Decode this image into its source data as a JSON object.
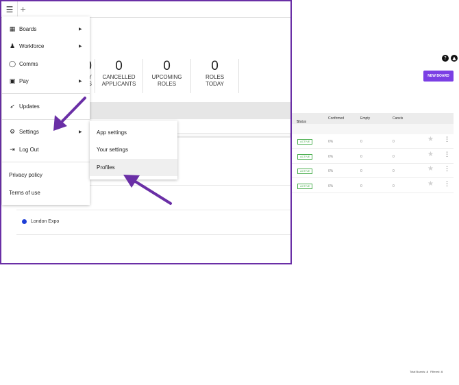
{
  "topbar": {
    "menu_icon": "hamburger-icon",
    "add_icon": "plus-icon",
    "add_label": "+"
  },
  "stats": [
    {
      "value": "0",
      "label_line1": "TY",
      "label_line2": "ES"
    },
    {
      "value": "0",
      "label_line1": "CANCELLED",
      "label_line2": "APPLICANTS"
    },
    {
      "value": "0",
      "label_line1": "UPCOMING",
      "label_line2": "ROLES"
    },
    {
      "value": "0",
      "label_line1": "ROLES",
      "label_line2": "TODAY"
    }
  ],
  "menu": {
    "items": [
      {
        "label": "Boards",
        "icon": "grid-icon",
        "has_submenu": true
      },
      {
        "label": "Workforce",
        "icon": "people-icon",
        "has_submenu": true
      },
      {
        "label": "Comms",
        "icon": "chat-icon",
        "has_submenu": false
      },
      {
        "label": "Pay",
        "icon": "cash-icon",
        "has_submenu": true
      },
      {
        "label": "Updates",
        "icon": "rocket-icon",
        "has_submenu": false
      },
      {
        "label": "Settings",
        "icon": "gear-icon",
        "has_submenu": true
      },
      {
        "label": "Log Out",
        "icon": "logout-icon",
        "has_submenu": false
      },
      {
        "label": "Privacy policy"
      },
      {
        "label": "Terms of use"
      }
    ]
  },
  "submenu": {
    "items": [
      {
        "label": "App settings"
      },
      {
        "label": "Your settings"
      },
      {
        "label": "Profiles",
        "highlighted": true
      }
    ]
  },
  "boards_list": {
    "board_name": "London Expo",
    "dot_color": "#1f3fd6"
  },
  "right_panel": {
    "help_icons": [
      "?",
      "▲"
    ],
    "new_board_label": "NEW BOARD",
    "columns": {
      "status": "Status",
      "confirmed": "Confirmed",
      "empty": "Empty",
      "canxls": "Canxls"
    },
    "rows": [
      {
        "status": "ACTIVE",
        "confirmed": "0%",
        "empty": "0",
        "canxls": "0"
      },
      {
        "status": "ACTIVE",
        "confirmed": "0%",
        "empty": "0",
        "canxls": "0"
      },
      {
        "status": "ACTIVE",
        "confirmed": "0%",
        "empty": "0",
        "canxls": "0"
      },
      {
        "status": "ACTIVE",
        "confirmed": "0%",
        "empty": "0",
        "canxls": "0"
      }
    ],
    "footer": {
      "total_label": "Total Boards:",
      "total_value": "4",
      "filtered_label": "Filtered:",
      "filtered_value": "4"
    }
  },
  "colors": {
    "accent": "#6a2fa6",
    "brand_button": "#7b3fe4",
    "active_status": "#4caf50"
  }
}
